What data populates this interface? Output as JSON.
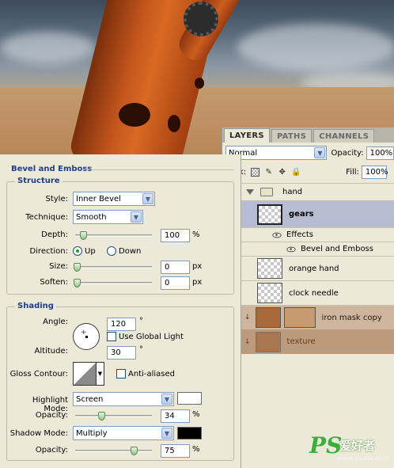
{
  "layers_panel": {
    "tabs": [
      "LAYERS",
      "PATHS",
      "CHANNELS"
    ],
    "blend_mode": "Normal",
    "opacity_label": "Opacity:",
    "opacity_value": "100%",
    "lock_label": "Lock:",
    "fill_label": "Fill:",
    "fill_value": "100%",
    "layers": {
      "group": "hand",
      "gears": "gears",
      "effects": "Effects",
      "bevel": "Bevel and Emboss",
      "orange_hand": "orange hand",
      "clock_needle": "clock needle",
      "iron_mask": "iron mask copy",
      "texture": "texture"
    }
  },
  "style_panel": {
    "title": "Bevel and Emboss",
    "structure": {
      "legend": "Structure",
      "style_label": "Style:",
      "style_value": "Inner Bevel",
      "technique_label": "Technique:",
      "technique_value": "Smooth",
      "depth_label": "Depth:",
      "depth_value": "100",
      "depth_unit": "%",
      "direction_label": "Direction:",
      "direction_up": "Up",
      "direction_down": "Down",
      "size_label": "Size:",
      "size_value": "0",
      "size_unit": "px",
      "soften_label": "Soften:",
      "soften_value": "0",
      "soften_unit": "px"
    },
    "shading": {
      "legend": "Shading",
      "angle_label": "Angle:",
      "angle_value": "120",
      "angle_unit": "°",
      "global_light": "Use Global Light",
      "altitude_label": "Altitude:",
      "altitude_value": "30",
      "altitude_unit": "°",
      "gloss_label": "Gloss Contour:",
      "anti_aliased": "Anti-aliased",
      "highlight_label": "Highlight Mode:",
      "highlight_value": "Screen",
      "highlight_color": "#ffffff",
      "highlight_opacity_label": "Opacity:",
      "highlight_opacity": "34",
      "shadow_label": "Shadow Mode:",
      "shadow_value": "Multiply",
      "shadow_color": "#000000",
      "shadow_opacity_label": "Opacity:",
      "shadow_opacity": "75",
      "pct": "%"
    }
  },
  "watermark": {
    "logo": "PS",
    "cn": "爱好者",
    "url": "www.psahz.com"
  }
}
